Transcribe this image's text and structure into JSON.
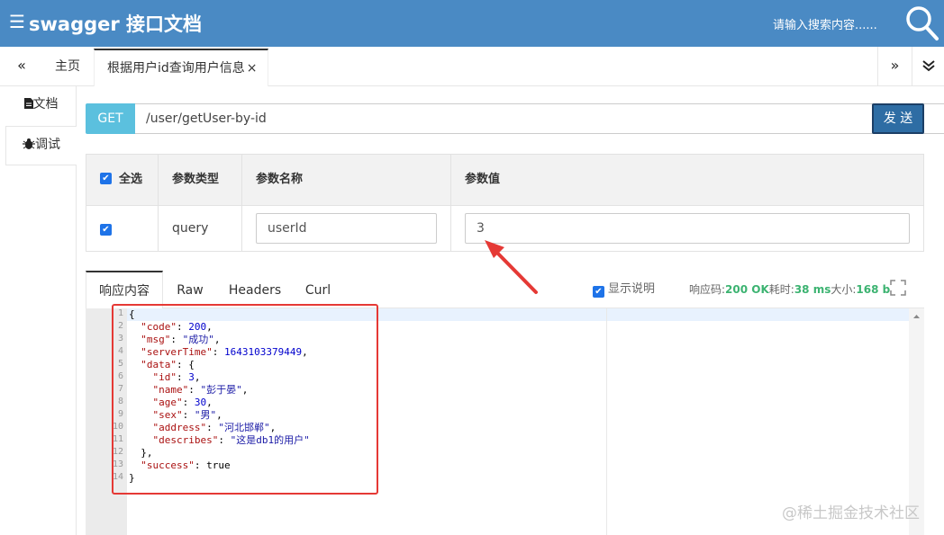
{
  "header": {
    "menu_icon": "☰",
    "title": "swagger 接口文档",
    "search_placeholder": "请输入搜索内容......"
  },
  "tabs": {
    "prev": "«",
    "home": "主页",
    "active": "根据用户id查询用户信息",
    "close": "×",
    "next": "»",
    "menu": "⌄"
  },
  "sidenav": {
    "doc": "文档",
    "debug": "调试"
  },
  "request": {
    "method": "GET",
    "url": "/user/getUser-by-id",
    "send": "发 送"
  },
  "params": {
    "headers": {
      "select_all": "全选",
      "type": "参数类型",
      "name": "参数名称",
      "value": "参数值"
    },
    "rows": [
      {
        "checked": true,
        "type": "query",
        "name": "userId",
        "value": "3"
      }
    ]
  },
  "response": {
    "tabs": [
      "响应内容",
      "Raw",
      "Headers",
      "Curl"
    ],
    "show_desc": "显示说明",
    "status_label": "响应码:",
    "status_value": "200 OK",
    "time_label": "耗时:",
    "time_value": "38 ms",
    "size_label": "大小:",
    "size_value": "168 b",
    "line_numbers": [
      "1",
      "2",
      "3",
      "4",
      "5",
      "6",
      "7",
      "8",
      "9",
      "10",
      "11",
      "12",
      "13",
      "14"
    ],
    "body": {
      "code": 200,
      "msg": "成功",
      "serverTime": 1643103379449,
      "data": {
        "id": 3,
        "name": "彭于晏",
        "age": 30,
        "sex": "男",
        "address": "河北邯郸",
        "describes": "这是db1的用户"
      },
      "success": "true"
    }
  },
  "watermark": "@稀土掘金技术社区",
  "colors": {
    "header": "#4a8ac4",
    "method": "#5bc0de",
    "send": "#2e6da4",
    "annotation": "#e53935",
    "status_green": "#3cb371"
  }
}
